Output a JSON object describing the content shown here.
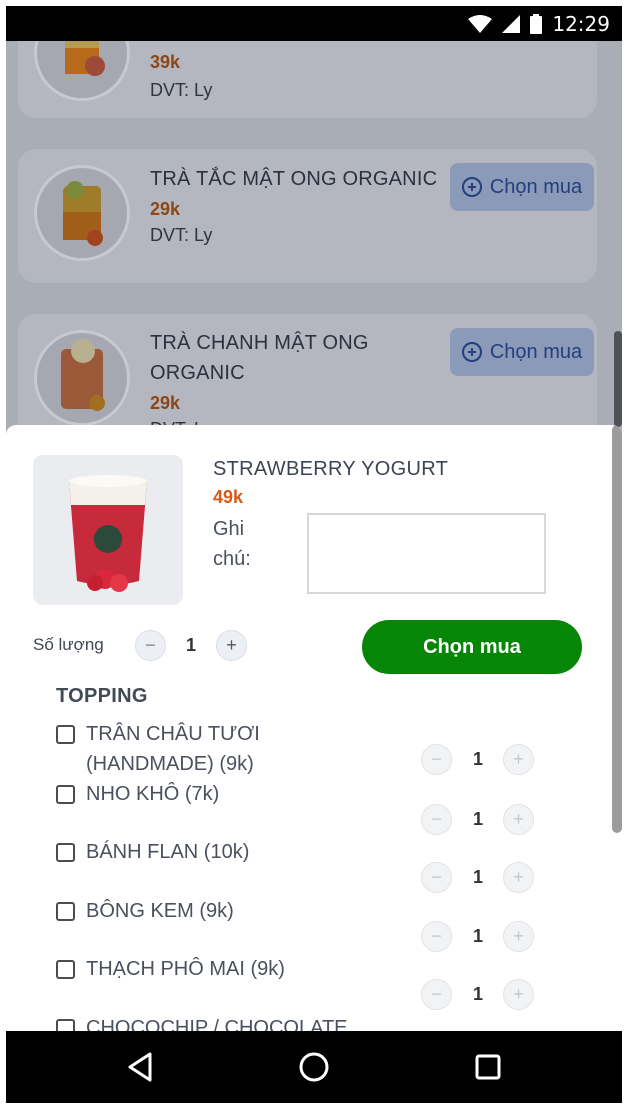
{
  "status_bar": {
    "time": "12:29",
    "icons": [
      "wifi-icon",
      "cell-signal-icon",
      "battery-icon"
    ]
  },
  "background_list": {
    "items": [
      {
        "title_visible": "",
        "price": "39k",
        "unit": "DVT: Ly",
        "button": ""
      },
      {
        "title": "TRÀ TẮC MẬT ONG ORGANIC",
        "price": "29k",
        "unit": "DVT: Ly",
        "button": "Chọn mua"
      },
      {
        "title_line1": "TRÀ CHANH MẬT ONG",
        "title_line2": "ORGANIC",
        "price": "29k",
        "unit": "DVT: L",
        "button": "Chọn mua"
      }
    ]
  },
  "sheet": {
    "product_name": "STRAWBERRY YOGURT",
    "product_price": "49k",
    "note_label_line1": "Ghi",
    "note_label_line2": "chú:",
    "note_value": "",
    "quantity_label": "Số lượng",
    "quantity_value": "1",
    "minus_symbol": "−",
    "plus_symbol": "+",
    "buy_button": "Chọn mua",
    "topping_heading": "TOPPING",
    "toppings": [
      {
        "line1": "TRÂN CHÂU TƯƠI",
        "line2": "(HANDMADE) (9k)",
        "qty": "1",
        "checked": false
      },
      {
        "line1": "NHO KHÔ (7k)",
        "qty": "1",
        "checked": false
      },
      {
        "line1": "BÁNH FLAN (10k)",
        "qty": "1",
        "checked": false
      },
      {
        "line1": "BÔNG KEM (9k)",
        "qty": "1",
        "checked": false
      },
      {
        "line1": "THẠCH PHÔ MAI (9k)",
        "qty": "1",
        "checked": false
      },
      {
        "line1": "CHOCOCHIP / CHOCOLATE",
        "checked": false
      }
    ]
  },
  "nav_bar": {
    "icons": [
      "back-triangle-icon",
      "home-circle-icon",
      "recents-square-icon"
    ]
  },
  "colors": {
    "accent_green": "#078507",
    "price_orange": "#d45a17",
    "chip_blue": "#243e7e"
  }
}
